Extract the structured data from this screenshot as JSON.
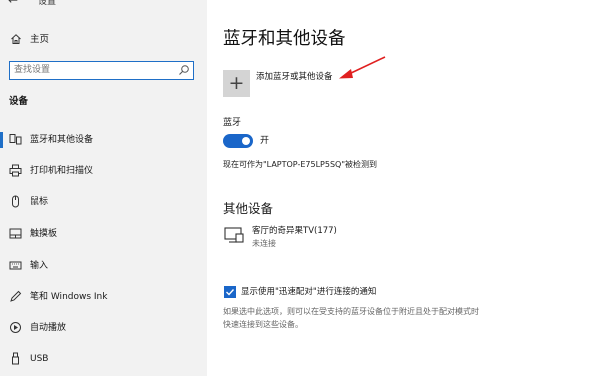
{
  "window": {
    "title": "设置"
  },
  "sidebar": {
    "home_label": "主页",
    "search_placeholder": "查找设置",
    "section_title": "设备",
    "items": [
      {
        "label": "蓝牙和其他设备",
        "icon": "bluetooth-devices-icon",
        "active": true
      },
      {
        "label": "打印机和扫描仪",
        "icon": "printer-icon"
      },
      {
        "label": "鼠标",
        "icon": "mouse-icon"
      },
      {
        "label": "触摸板",
        "icon": "touchpad-icon"
      },
      {
        "label": "输入",
        "icon": "keyboard-icon"
      },
      {
        "label": "笔和 Windows Ink",
        "icon": "pen-icon"
      },
      {
        "label": "自动播放",
        "icon": "autoplay-icon"
      },
      {
        "label": "USB",
        "icon": "usb-icon"
      }
    ]
  },
  "main": {
    "title": "蓝牙和其他设备",
    "add_device_label": "添加蓝牙或其他设备",
    "bluetooth_label": "蓝牙",
    "bluetooth_state": "开",
    "discoverable_text": "现在可作为\"LAPTOP-E75LP5SQ\"被检测到",
    "other_devices_title": "其他设备",
    "devices": [
      {
        "name": "客厅的奇异果TV(177)",
        "status": "未连接",
        "icon": "display-device-icon"
      }
    ],
    "notify_checkbox_label": "显示使用\"迅速配对\"进行连接的通知",
    "notify_description_lines": [
      "如果选中此选项，则可以在受支持的蓝牙设备位于附近且处于配对模式时",
      "快速连接到这些设备。"
    ]
  },
  "colors": {
    "accent": "#1a66c9",
    "sidebar_bg": "#f2f2f2",
    "annotation_arrow": "#e02020"
  }
}
